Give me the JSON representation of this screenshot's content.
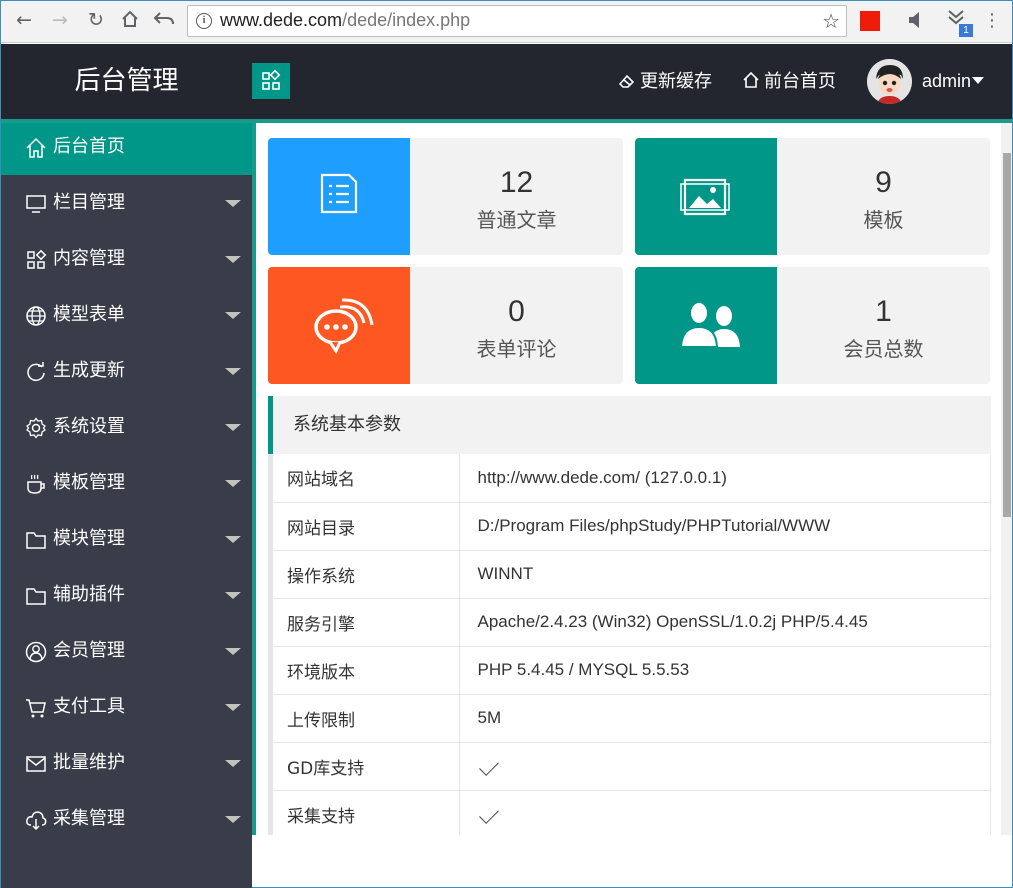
{
  "browser": {
    "url_host": "www.dede.com",
    "url_path": "/dede/index.php",
    "extension_badge": "1"
  },
  "header": {
    "logo": "后台管理",
    "refresh_cache": "更新缓存",
    "front_home": "前台首页",
    "user": "admin"
  },
  "colors": {
    "topbar": "#23262e",
    "sidebar": "#393d49",
    "accent": "#009688",
    "blue": "#1e9fff",
    "orange": "#ff5722"
  },
  "sidebar": {
    "items": [
      {
        "label": "后台首页",
        "icon": "home-icon"
      },
      {
        "label": "栏目管理",
        "icon": "monitor-icon"
      },
      {
        "label": "内容管理",
        "icon": "apps-icon"
      },
      {
        "label": "模型表单",
        "icon": "globe-icon"
      },
      {
        "label": "生成更新",
        "icon": "refresh-icon"
      },
      {
        "label": "系统设置",
        "icon": "gear-icon"
      },
      {
        "label": "模板管理",
        "icon": "cup-icon"
      },
      {
        "label": "模块管理",
        "icon": "folder-icon"
      },
      {
        "label": "辅助插件",
        "icon": "folder-icon"
      },
      {
        "label": "会员管理",
        "icon": "user-circle-icon"
      },
      {
        "label": "支付工具",
        "icon": "cart-icon"
      },
      {
        "label": "批量维护",
        "icon": "mail-icon"
      },
      {
        "label": "采集管理",
        "icon": "cloud-download-icon"
      }
    ]
  },
  "stats": [
    {
      "value": "12",
      "label": "普通文章",
      "icon": "document-icon"
    },
    {
      "value": "9",
      "label": "模板",
      "icon": "image-icon"
    },
    {
      "value": "0",
      "label": "表单评论",
      "icon": "chat-icon"
    },
    {
      "value": "1",
      "label": "会员总数",
      "icon": "users-icon"
    }
  ],
  "system_info": {
    "title": "系统基本参数",
    "rows": [
      {
        "key": "网站域名",
        "value": "http://www.dede.com/ (127.0.0.1)"
      },
      {
        "key": "网站目录",
        "value": "D:/Program Files/phpStudy/PHPTutorial/WWW"
      },
      {
        "key": "操作系统",
        "value": "WINNT"
      },
      {
        "key": "服务引擎",
        "value": "Apache/2.4.23 (Win32) OpenSSL/1.0.2j PHP/5.4.45"
      },
      {
        "key": "环境版本",
        "value": "PHP 5.4.45 / MYSQL 5.5.53"
      },
      {
        "key": "上传限制",
        "value": "5M"
      },
      {
        "key": "GD库支持",
        "value": ""
      },
      {
        "key": "采集支持",
        "value": ""
      }
    ]
  }
}
